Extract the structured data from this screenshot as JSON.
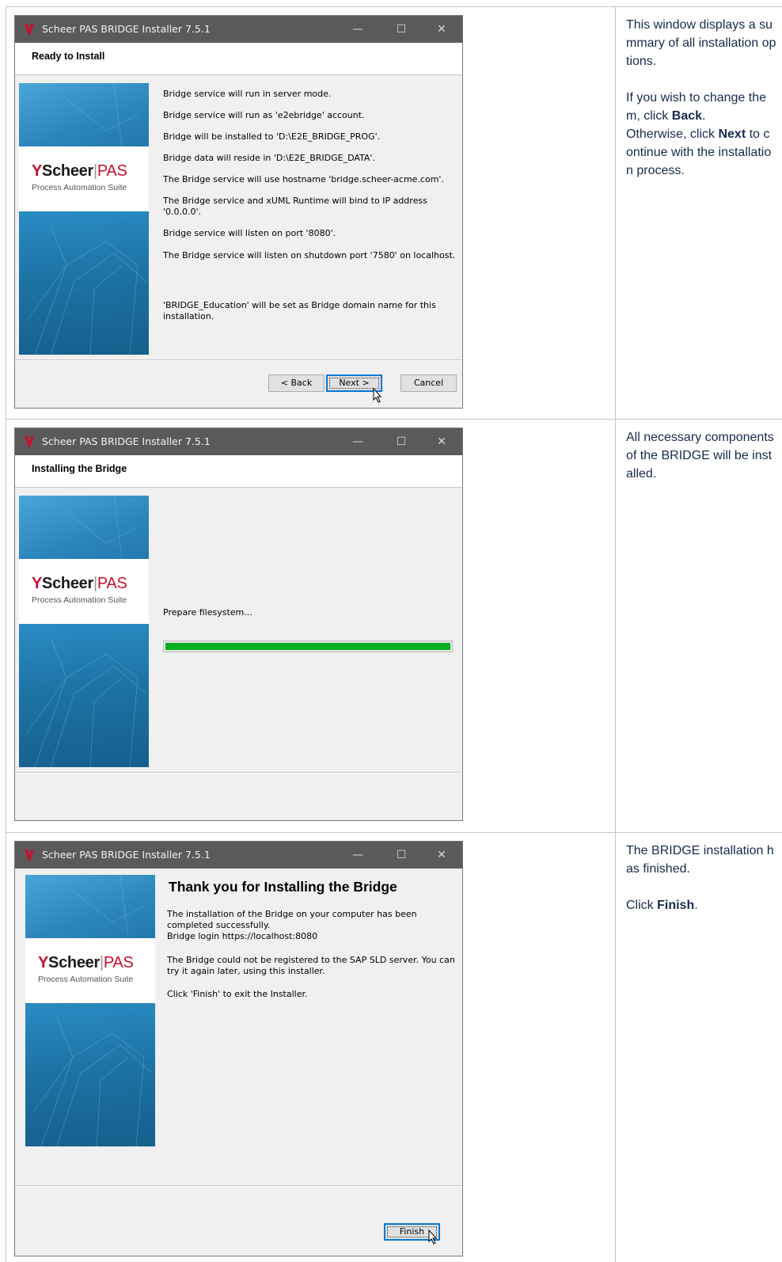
{
  "window_title": "Scheer PAS BRIDGE Installer 7.5.1",
  "window_controls": {
    "minimize": "—",
    "maximize": "☐",
    "close": "✕"
  },
  "banner": {
    "brand_name": "Scheer",
    "brand_sep": "|",
    "brand_pas": "PAS",
    "subtitle": "Process Automation Suite"
  },
  "accent_color": "#c8102e",
  "progress_color": "#06b025",
  "row1": {
    "header": "Ready to Install",
    "messages": [
      "Bridge service will run in server mode.",
      "Bridge service will run as 'e2ebridge' account.",
      "Bridge will be installed to 'D:\\E2E_BRIDGE_PROG'.",
      "Bridge data will reside in 'D:\\E2E_BRIDGE_DATA'.",
      "The Bridge service will use hostname 'bridge.scheer-acme.com'.",
      "The Bridge service and xUML Runtime will bind to IP address '0.0.0.0'.",
      "Bridge service will listen on port '8080'.",
      "The Bridge service will listen on shutdown port '7580' on localhost.",
      "'BRIDGE_Education' will be set as Bridge domain name for this installation."
    ],
    "buttons": {
      "back": "< Back",
      "next": "Next >",
      "cancel": "Cancel"
    },
    "desc": {
      "p1": "This window displays a summary of all installation options.",
      "p2_pre": "If you wish to change them, click ",
      "p2_bold": "Back",
      "p2_post": ".",
      "p3_pre": "Otherwise, click ",
      "p3_bold": "Next",
      "p3_post": " to continue with the installation process."
    }
  },
  "row2": {
    "header": "Installing the Bridge",
    "status": "Prepare filesystem...",
    "progress": 1.0,
    "desc": "All necessary components of the BRIDGE will be installed."
  },
  "row3": {
    "title": "Thank you for Installing the Bridge",
    "messages": [
      "The installation of the Bridge on your computer has been completed successfully.",
      "Bridge login https://localhost:8080",
      "The Bridge could not be registered to the SAP SLD server. You can try it again later, using this installer.",
      "Click 'Finish' to exit the Installer."
    ],
    "buttons": {
      "finish": "Finish"
    },
    "desc": {
      "p1": "The BRIDGE installation has finished.",
      "p2_pre": "Click ",
      "p2_bold": "Finish",
      "p2_post": "."
    }
  }
}
